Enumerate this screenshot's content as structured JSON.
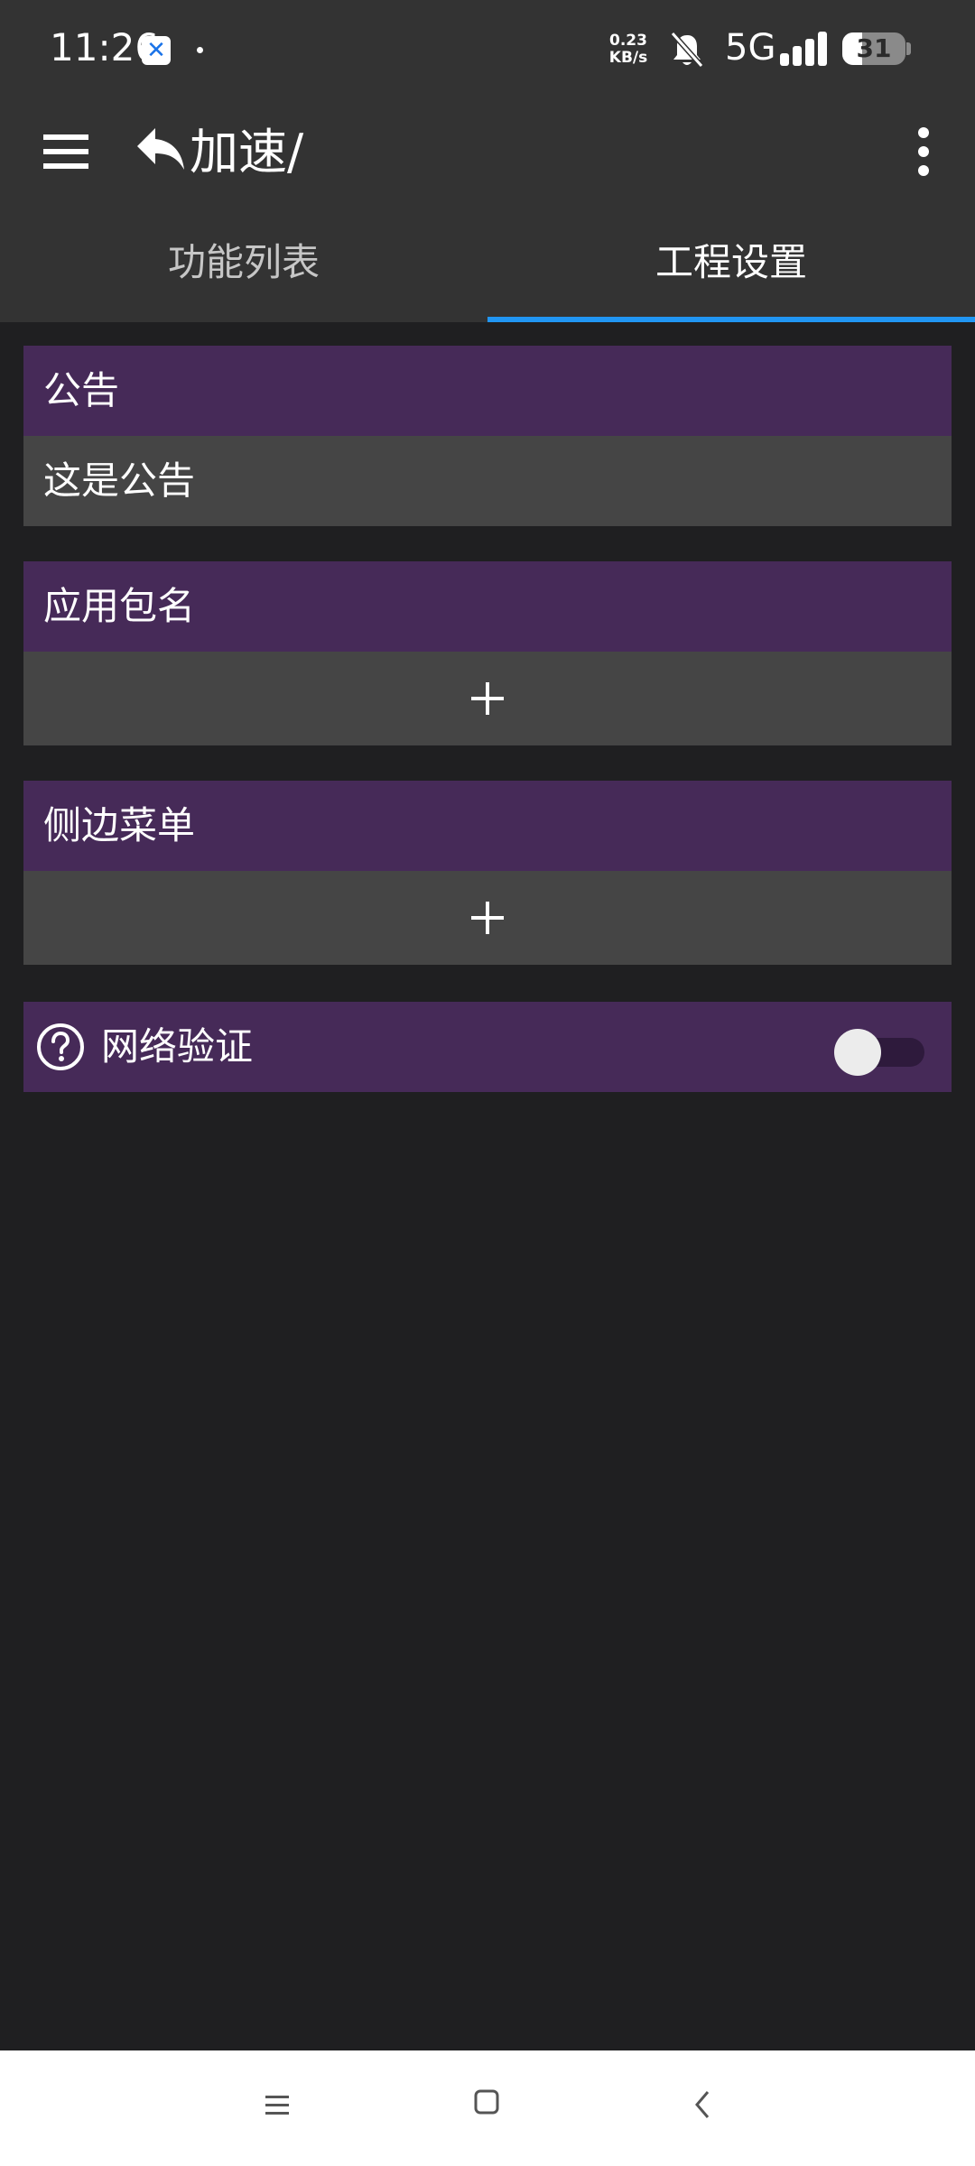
{
  "status_bar": {
    "time": "11:26",
    "app_notification_icon": "x-app-icon",
    "speed_value": "0.23",
    "speed_unit": "KB/s",
    "network": "5G",
    "battery": "31",
    "battery_level": 0.31
  },
  "app_bar": {
    "title": "加速/",
    "menu_icon": "hamburger-menu-icon",
    "back_icon": "reply-arrow-icon",
    "more_icon": "more-vert-icon"
  },
  "tabs": [
    {
      "label": "功能列表",
      "selected": false
    },
    {
      "label": "工程设置",
      "selected": true
    }
  ],
  "sections": {
    "notice": {
      "title": "公告",
      "content": "这是公告"
    },
    "package": {
      "title": "应用包名",
      "add_icon": "plus-icon"
    },
    "side_menu": {
      "title": "侧边菜单",
      "add_icon": "plus-icon"
    },
    "network_verify": {
      "title": "网络验证",
      "help_icon": "help-circle-icon",
      "enabled": false
    }
  },
  "colors": {
    "background": "#1f1f21",
    "bar": "#333333",
    "section_header": "#462a58",
    "section_body": "#454545",
    "tab_indicator": "#2196f3"
  }
}
